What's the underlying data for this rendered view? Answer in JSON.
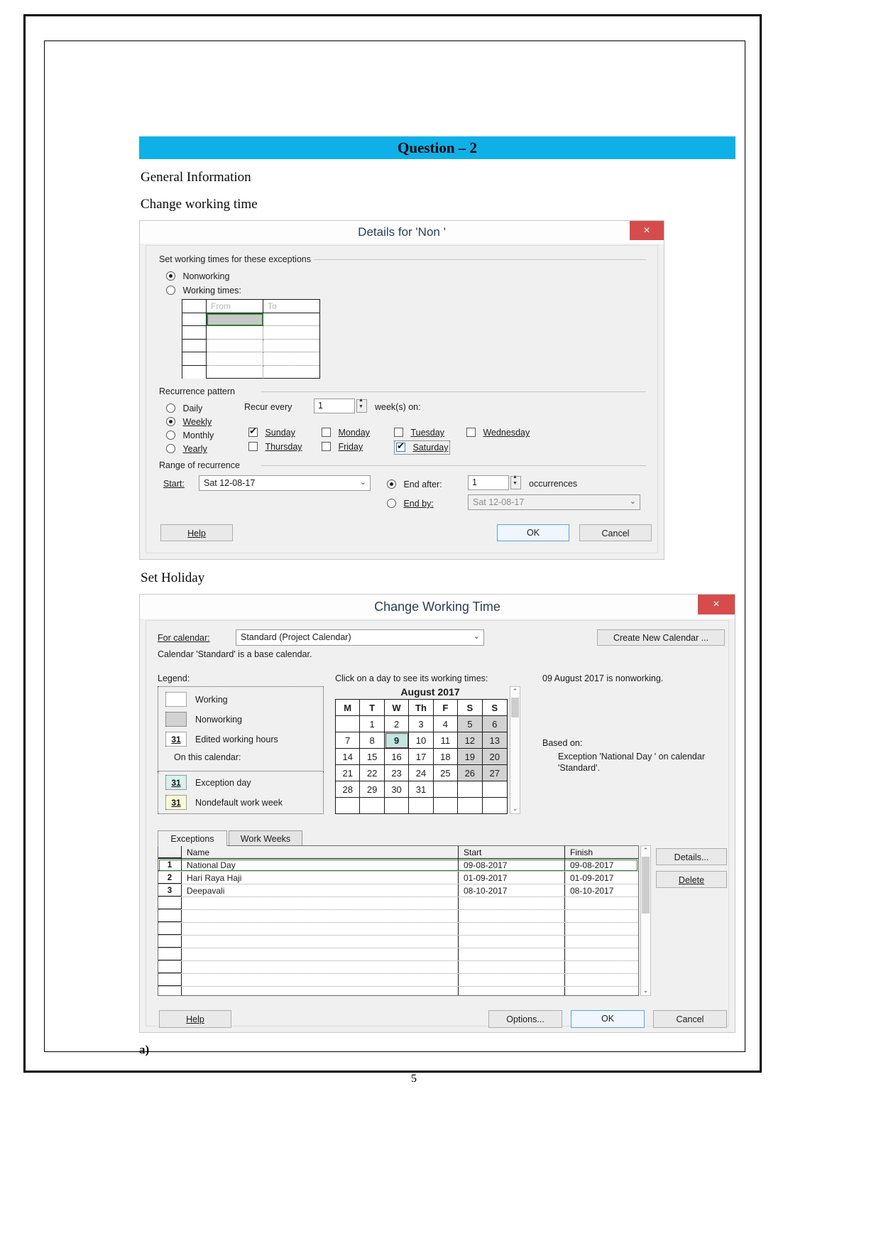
{
  "document": {
    "banner_title": "Question – 2",
    "section_general": "General Information",
    "section_change_working_time": "Change working time",
    "section_set_holiday": "Set Holiday",
    "part_label": "a)",
    "page_number": "5",
    "accent_color": "#0FB0E8"
  },
  "dialog_details": {
    "title": "Details for 'Non '",
    "close_label": "×",
    "group_exceptions": {
      "title": "Set working times for these exceptions",
      "option_nonworking": "Nonworking",
      "option_working_times": "Working times:",
      "selected": "Nonworking",
      "table_headers": [
        "From",
        "To"
      ],
      "row_count": 6
    },
    "group_recurrence": {
      "title": "Recurrence pattern",
      "options": [
        "Daily",
        "Weekly",
        "Monthly",
        "Yearly"
      ],
      "selected": "Weekly",
      "recur_every_label": "Recur every",
      "recur_every_value": "1",
      "weeks_on_label": "week(s) on:",
      "days": [
        {
          "label": "Sunday",
          "checked": true
        },
        {
          "label": "Monday",
          "checked": false
        },
        {
          "label": "Tuesday",
          "checked": false
        },
        {
          "label": "Wednesday",
          "checked": false
        },
        {
          "label": "Thursday",
          "checked": false
        },
        {
          "label": "Friday",
          "checked": false
        },
        {
          "label": "Saturday",
          "checked": true
        }
      ]
    },
    "group_range": {
      "title": "Range of recurrence",
      "start_label": "Start:",
      "start_value": "Sat 12-08-17",
      "end_after_label": "End after:",
      "end_after_value": "1",
      "occurrences_label": "occurrences",
      "end_by_label": "End by:",
      "end_by_value": "Sat 12-08-17",
      "selected": "End after"
    },
    "buttons": {
      "help": "Help",
      "ok": "OK",
      "cancel": "Cancel"
    }
  },
  "dialog_working_time": {
    "title": "Change Working Time",
    "close_label": "×",
    "for_calendar_label": "For calendar:",
    "for_calendar_value": "Standard (Project Calendar)",
    "create_new_calendar": "Create New Calendar ...",
    "base_calendar_note": "Calendar 'Standard' is a base calendar.",
    "legend": {
      "title": "Legend:",
      "items": [
        {
          "glyph": "",
          "label": "Working",
          "kind": "working"
        },
        {
          "glyph": "",
          "label": "Nonworking",
          "kind": "nonworking"
        },
        {
          "glyph": "31",
          "label": "Edited working hours",
          "kind": "edited"
        }
      ],
      "on_this_calendar": "On this calendar:",
      "items2": [
        {
          "glyph": "31",
          "label": "Exception day",
          "kind": "exception"
        },
        {
          "glyph": "31",
          "label": "Nondefault work week",
          "kind": "nondefault"
        }
      ]
    },
    "calendar": {
      "hint": "Click on a day to see its working times:",
      "month": "August 2017",
      "day_headers": [
        "M",
        "T",
        "W",
        "Th",
        "F",
        "S",
        "S"
      ],
      "weeks": [
        [
          "",
          "1",
          "2",
          "3",
          "4",
          "5",
          "6"
        ],
        [
          "7",
          "8",
          "9",
          "10",
          "11",
          "12",
          "13"
        ],
        [
          "14",
          "15",
          "16",
          "17",
          "18",
          "19",
          "20"
        ],
        [
          "21",
          "22",
          "23",
          "24",
          "25",
          "26",
          "27"
        ],
        [
          "28",
          "29",
          "30",
          "31",
          "",
          "",
          ""
        ],
        [
          "",
          "",
          "",
          "",
          "",
          "",
          ""
        ]
      ],
      "nonworking_days": [
        "5",
        "6",
        "12",
        "13",
        "19",
        "20",
        "26",
        "27"
      ],
      "exception_day": "9"
    },
    "info": {
      "status": "09 August 2017 is nonworking.",
      "based_on_label": "Based on:",
      "based_on_text": "Exception 'National Day ' on calendar 'Standard'."
    },
    "tabs": [
      {
        "label": "Exceptions",
        "active": true
      },
      {
        "label": "Work Weeks",
        "active": false
      }
    ],
    "exceptions_table": {
      "headers": [
        "",
        "Name",
        "Start",
        "Finish"
      ],
      "rows": [
        {
          "index": "1",
          "name": "National Day",
          "start": "09-08-2017",
          "finish": "09-08-2017",
          "selected": true
        },
        {
          "index": "2",
          "name": "Hari Raya Haji",
          "start": "01-09-2017",
          "finish": "01-09-2017",
          "selected": false
        },
        {
          "index": "3",
          "name": "Deepavali",
          "start": "08-10-2017",
          "finish": "08-10-2017",
          "selected": false
        }
      ],
      "empty_rows": 8
    },
    "side_buttons": {
      "details": "Details...",
      "delete": "Delete"
    },
    "buttons": {
      "help": "Help",
      "options": "Options...",
      "ok": "OK",
      "cancel": "Cancel"
    }
  }
}
